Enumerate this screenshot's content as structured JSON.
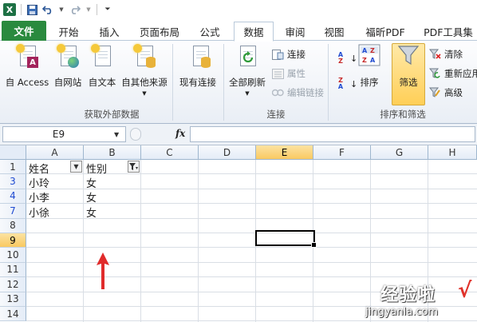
{
  "quick_access": {
    "app_icon": "excel-icon",
    "save_icon": "save-icon",
    "undo_icon": "undo-icon",
    "redo_icon": "redo-icon",
    "customize_icon": "customize-icon"
  },
  "tabs": [
    {
      "label": "文件",
      "active": false
    },
    {
      "label": "开始",
      "active": false
    },
    {
      "label": "插入",
      "active": false
    },
    {
      "label": "页面布局",
      "active": false
    },
    {
      "label": "公式",
      "active": false
    },
    {
      "label": "数据",
      "active": true
    },
    {
      "label": "审阅",
      "active": false
    },
    {
      "label": "视图",
      "active": false
    },
    {
      "label": "福昕PDF",
      "active": false
    },
    {
      "label": "PDF工具集",
      "active": false
    }
  ],
  "ribbon": {
    "external_data": {
      "group_label": "获取外部数据",
      "from_access": "自 Access",
      "from_web": "自网站",
      "from_text": "自文本",
      "from_other": "自其他来源",
      "existing_connections": "现有连接"
    },
    "connections": {
      "group_label": "连接",
      "refresh_all": "全部刷新",
      "connections": "连接",
      "properties": "属性",
      "edit_links": "编辑链接"
    },
    "sort_filter": {
      "group_label": "排序和筛选",
      "sort": "排序",
      "filter": "筛选",
      "clear": "清除",
      "reapply": "重新应用",
      "advanced": "高级"
    }
  },
  "formula_bar": {
    "name_box": "E9",
    "fx": "fx",
    "formula": ""
  },
  "columns": [
    "A",
    "B",
    "C",
    "D",
    "E",
    "F",
    "G",
    "H"
  ],
  "selected_column": "E",
  "rows": [
    {
      "num": "1",
      "a": "姓名",
      "b": "性别",
      "filtered": false,
      "selected": false
    },
    {
      "num": "3",
      "a": "小玲",
      "b": "女",
      "filtered": true,
      "selected": false
    },
    {
      "num": "4",
      "a": "小李",
      "b": "女",
      "filtered": true,
      "selected": false
    },
    {
      "num": "7",
      "a": "小徐",
      "b": "女",
      "filtered": true,
      "selected": false
    },
    {
      "num": "8",
      "a": "",
      "b": "",
      "filtered": false,
      "selected": false
    },
    {
      "num": "9",
      "a": "",
      "b": "",
      "filtered": false,
      "selected": true
    },
    {
      "num": "10",
      "a": "",
      "b": "",
      "filtered": false,
      "selected": false
    },
    {
      "num": "11",
      "a": "",
      "b": "",
      "filtered": false,
      "selected": false
    },
    {
      "num": "12",
      "a": "",
      "b": "",
      "filtered": false,
      "selected": false
    },
    {
      "num": "13",
      "a": "",
      "b": "",
      "filtered": false,
      "selected": false
    },
    {
      "num": "14",
      "a": "",
      "b": "",
      "filtered": false,
      "selected": false
    }
  ],
  "annotation_arrow_color": "#e02b2b",
  "watermark": {
    "title": "经验啦",
    "check": "√",
    "url": "jingyanla.com"
  }
}
